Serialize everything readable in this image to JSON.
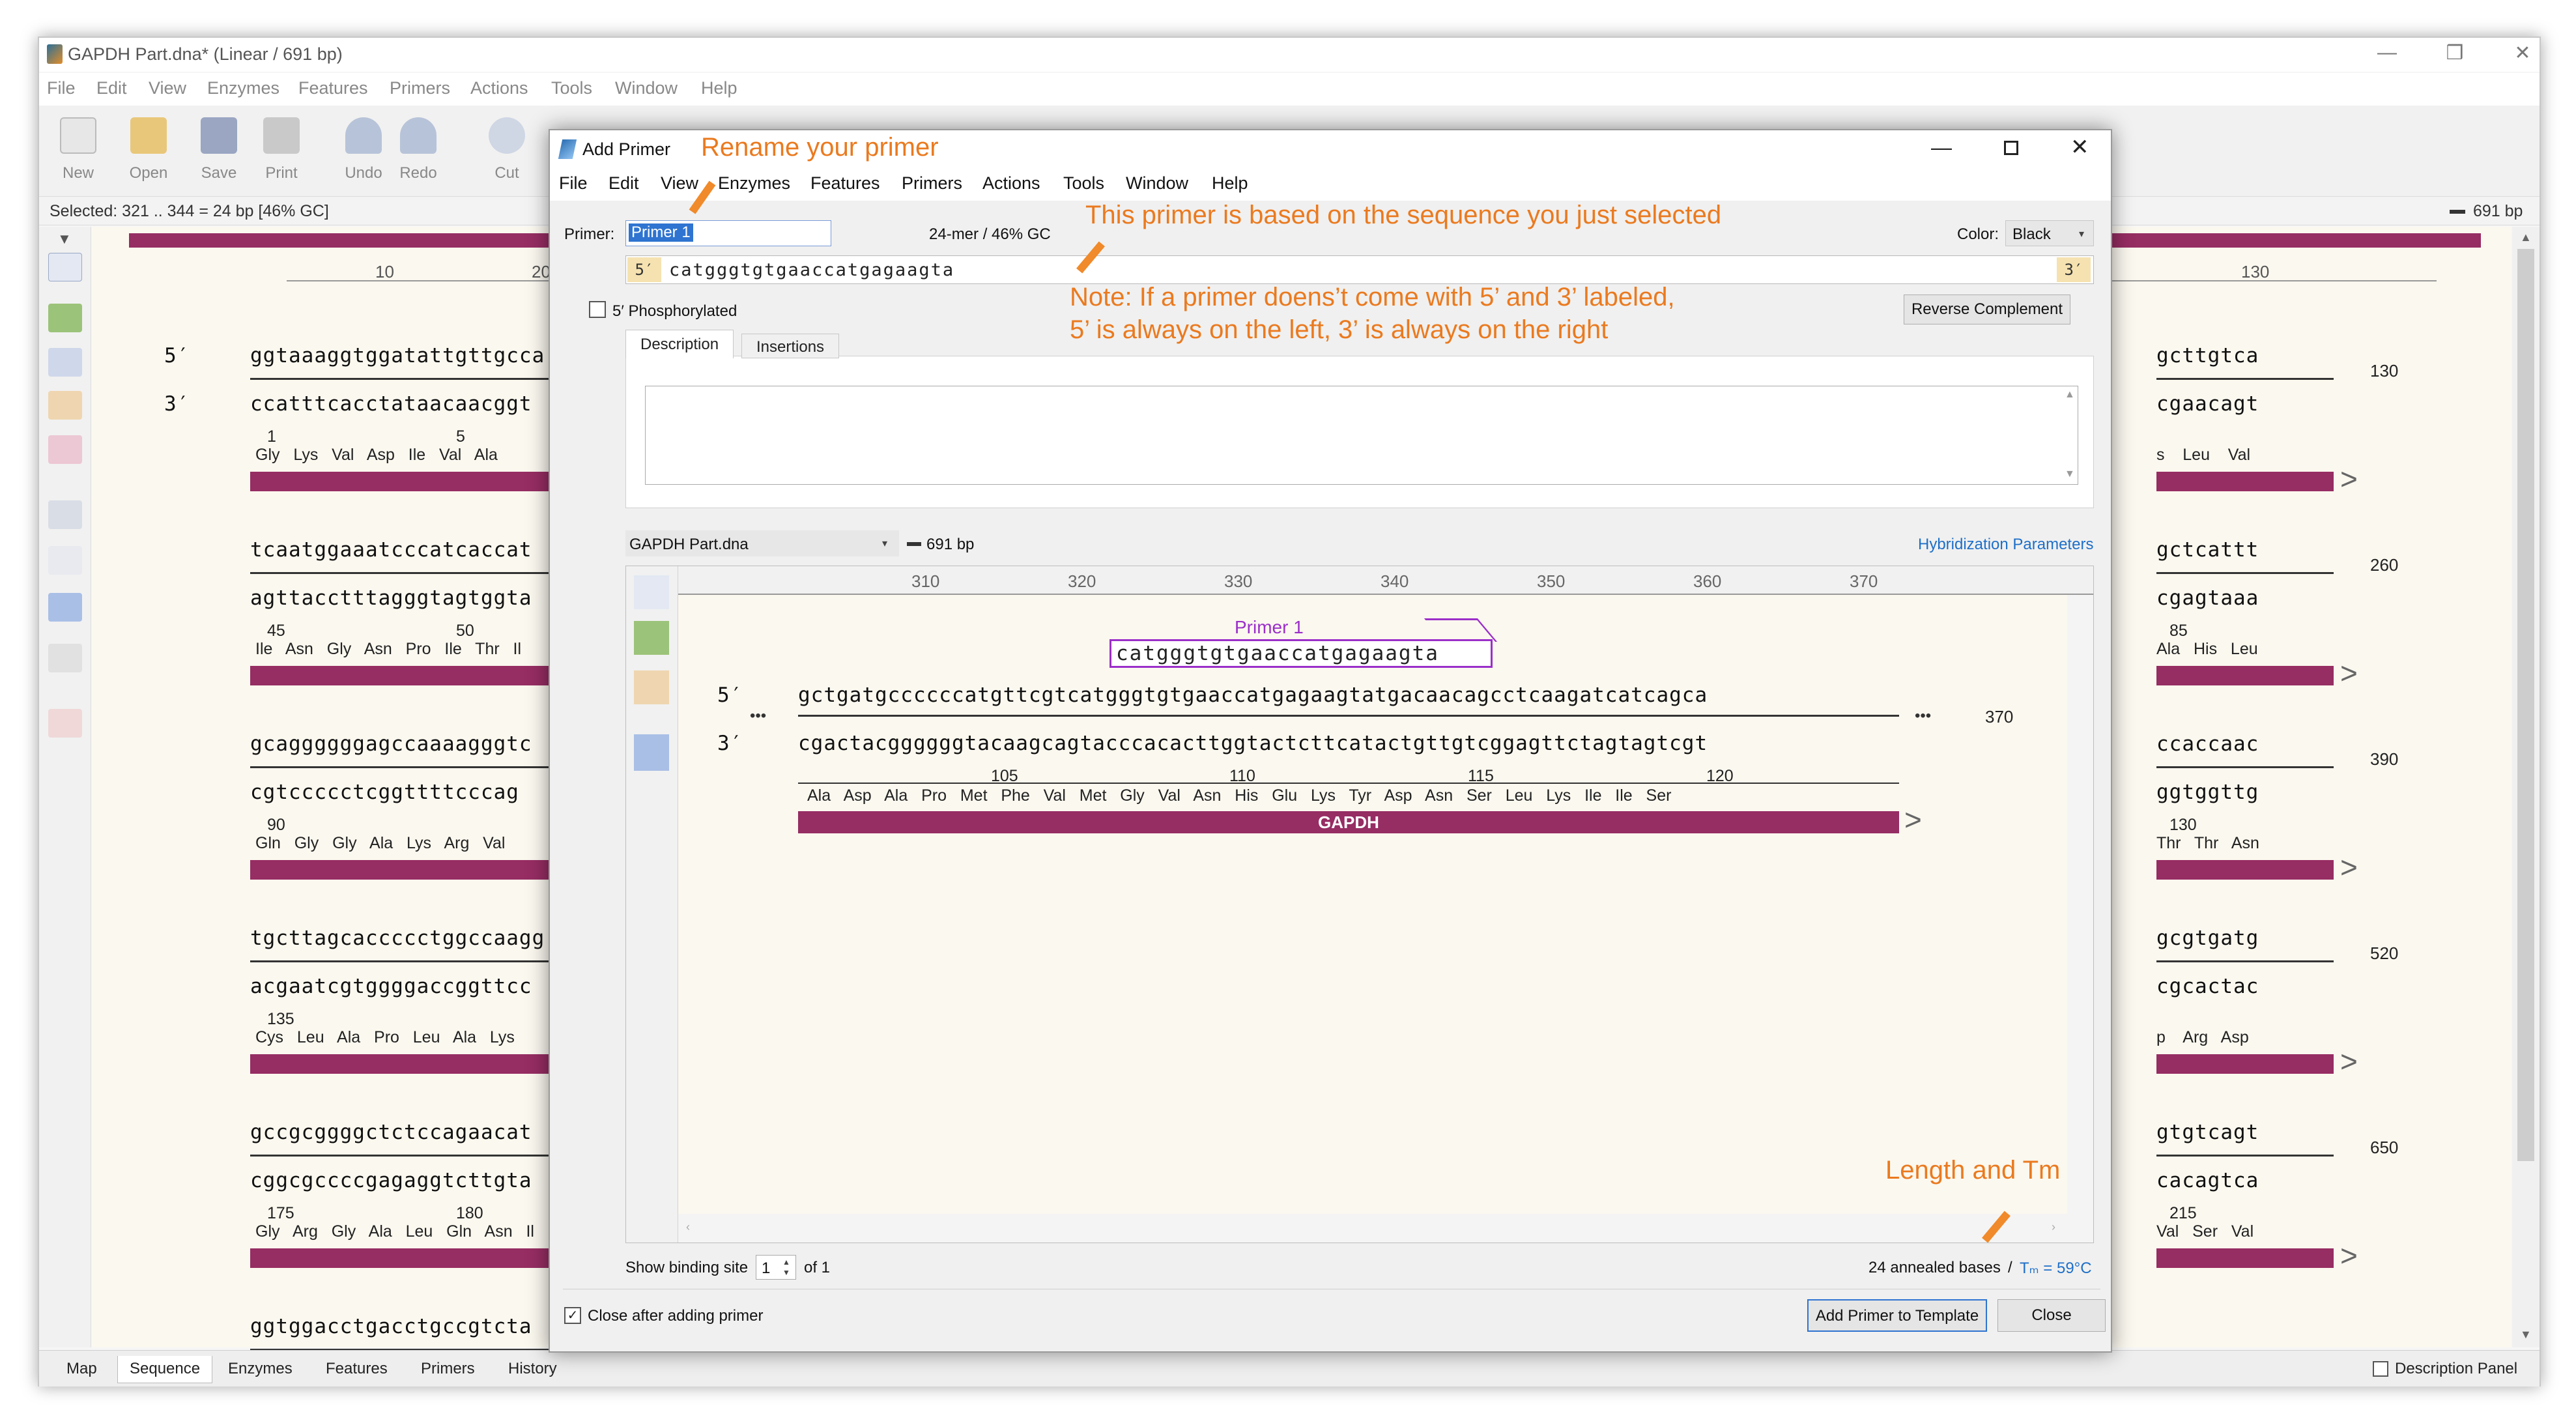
{
  "window": {
    "title": "GAPDH Part.dna* (Linear / 691 bp)",
    "controls": [
      "—",
      "❒",
      "✕"
    ]
  },
  "menu": [
    "File",
    "Edit",
    "View",
    "Enzymes",
    "Features",
    "Primers",
    "Actions",
    "Tools",
    "Window",
    "Help"
  ],
  "toolbar": [
    "New",
    "Open",
    "Save",
    "Print",
    "Undo",
    "Redo",
    "Cut"
  ],
  "selection": {
    "text": "Selected:  321 .. 344  =  24 bp     [46% GC]",
    "length": "691 bp"
  },
  "ruler": {
    "top": [
      "10",
      "20"
    ],
    "right": "130"
  },
  "rows": [
    {
      "top": "ggtaaaggtggatattgttgcca",
      "bottom": "ccatttcacctataacaacggt",
      "aa": "Gly   Lys   Val   Asp   Ile   Val   Ala",
      "nums": [
        "1",
        "5"
      ],
      "right_top": "gcttgtca",
      "right_bottom": "cgaacagt",
      "right_aa": "s    Leu    Val",
      "num": "130",
      "strand5": "5′",
      "strand3": "3′"
    },
    {
      "top": "tcaatggaaatcccatcaccat",
      "bottom": "agttacctttagggtagtggta",
      "aa": "Ile   Asn   Gly   Asn   Pro   Ile   Thr   Il",
      "nums": [
        "45",
        "50"
      ],
      "right_top": "gctcattt",
      "right_bottom": "cgagtaaa",
      "right_aa": "Ala   His   Leu",
      "right_num": "85",
      "num": "260"
    },
    {
      "top": "gcaggggggagccaaaagggtc",
      "bottom": "cgtccccctcggttttcccag",
      "aa": "Gln   Gly   Gly   Ala   Lys   Arg   Val",
      "nums": [
        "90"
      ],
      "right_top": "ccaccaac",
      "right_bottom": "ggtggttg",
      "right_aa": "Thr   Thr   Asn",
      "right_num": "130",
      "num": "390"
    },
    {
      "top": "tgcttagcaccccctggccaagg",
      "bottom": "acgaatcgtggggaccggttcc",
      "aa": "Cys   Leu   Ala   Pro   Leu   Ala   Lys",
      "nums": [
        "135"
      ],
      "right_top": "gcgtgatg",
      "right_bottom": "cgcactac",
      "right_aa": "p    Arg   Asp",
      "num": "520"
    },
    {
      "top": "gccgcggggctctccagaacat",
      "bottom": "cggcgccccgagaggtcttgta",
      "aa": "Gly   Arg   Gly   Ala   Leu   Gln   Asn   Il",
      "nums": [
        "175",
        "180"
      ],
      "right_top": "gtgtcagt",
      "right_bottom": "cacagtca",
      "right_aa": "Val   Ser   Val",
      "right_num": "215",
      "num": "650"
    },
    {
      "top": "ggtggacctgacctgccgtcta",
      "bottom": "",
      "aa": "",
      "nums": [],
      "right_top": "",
      "right_bottom": "",
      "right_aa": "",
      "num": ""
    }
  ],
  "tabs": [
    "Map",
    "Sequence",
    "Enzymes",
    "Features",
    "Primers",
    "History"
  ],
  "description_panel": "Description Panel",
  "dialog": {
    "title": "Add Primer",
    "menu": [
      "File",
      "Edit",
      "View",
      "Enzymes",
      "Features",
      "Primers",
      "Actions",
      "Tools",
      "Window",
      "Help"
    ],
    "primer_label": "Primer:",
    "primer_name": "Primer 1",
    "primer_stats": "24-mer  /  46% GC",
    "color_label": "Color:",
    "color_value": "Black",
    "five_prime": "5′",
    "three_prime": "3′",
    "sequence": "catgggtgtgaaccatgagaagta",
    "phosphorylated": "5′ Phosphorylated",
    "reverse_complement": "Reverse Complement",
    "tabs": [
      "Description",
      "Insertions"
    ],
    "template_file": "GAPDH Part.dna",
    "template_len": "691 bp",
    "hybridization": "Hybridization Parameters",
    "ruler": [
      "310",
      "320",
      "330",
      "340",
      "350",
      "360",
      "370"
    ],
    "preview": {
      "primer_label": "Primer 1",
      "primer_seq": "catgggtgtgaaccatgagaagta",
      "top": "gctgatgccccccatgttcgtcatgggtgtgaaccatgagaagtatgacaacagcctcaagatcatcagca",
      "bottom": "cgactacggggggtacaagcagtacccacacttggtactcttcatactgttgtcggagttctagtagtcgt",
      "aa": "Ala   Asp   Ala   Pro   Met   Phe   Val   Met   Gly   Val   Asn   His   Glu   Lys   Tyr   Asp   Asn   Ser   Leu   Lys   Ile   Ile   Ser",
      "aa_nums": [
        "105",
        "110",
        "115",
        "120"
      ],
      "row_num": "370",
      "feature": "GAPDH",
      "dots": "•••"
    },
    "binding_label": "Show binding site",
    "binding_value": "1",
    "binding_of": "of 1",
    "annealed": "24 annealed bases",
    "tm_sep": "/",
    "tm": "Tₘ = 59°C",
    "close_after": "Close after adding primer",
    "add_button": "Add Primer to Template",
    "close_button": "Close"
  },
  "annotations": {
    "rename": "Rename your primer",
    "based_on": "This primer is based on the sequence you just selected",
    "note_line1": "Note: If a primer doens’t come with 5’ and 3’ labeled,",
    "note_line2": "5’ is always on the left, 3’ is always on the right",
    "length_tm": "Length and Tm"
  },
  "colors": {
    "feature": "#962d63",
    "annotation": "#ea7a1f",
    "primer_box": "#9b2fc9",
    "link": "#1e6fc8"
  }
}
